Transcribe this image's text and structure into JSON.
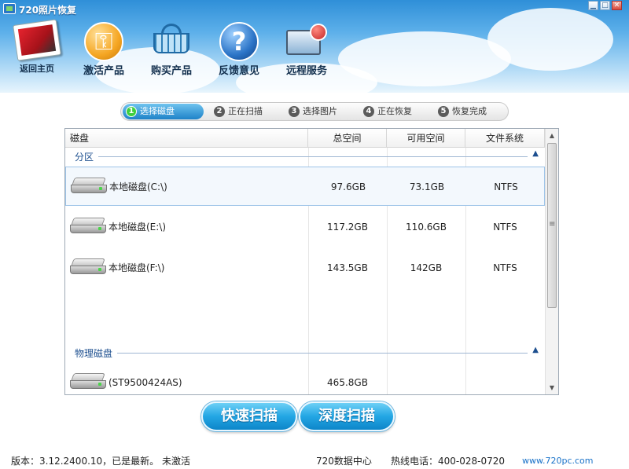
{
  "window": {
    "title": "720照片恢复",
    "controls": {
      "minimize": "▁",
      "maximize": "□",
      "close": "✕"
    }
  },
  "toolbar": {
    "home": "返回主页",
    "activate": "激活产品",
    "buy": "购买产品",
    "feedback": "反馈意见",
    "remote": "远程服务"
  },
  "steps": [
    {
      "num": "1",
      "label": "选择磁盘",
      "active": true
    },
    {
      "num": "2",
      "label": "正在扫描",
      "active": false
    },
    {
      "num": "3",
      "label": "选择图片",
      "active": false
    },
    {
      "num": "4",
      "label": "正在恢复",
      "active": false
    },
    {
      "num": "5",
      "label": "恢复完成",
      "active": false
    }
  ],
  "table": {
    "columns": {
      "disk": "磁盘",
      "total": "总空间",
      "free": "可用空间",
      "fs": "文件系统"
    },
    "partition_group": "分区",
    "physical_group": "物理磁盘",
    "chevron": "▲",
    "partitions": [
      {
        "name": "本地磁盘(C:\\)",
        "total": "97.6GB",
        "free": "73.1GB",
        "fs": "NTFS"
      },
      {
        "name": "本地磁盘(E:\\)",
        "total": "117.2GB",
        "free": "110.6GB",
        "fs": "NTFS"
      },
      {
        "name": "本地磁盘(F:\\)",
        "total": "143.5GB",
        "free": "142GB",
        "fs": "NTFS"
      }
    ],
    "physical": [
      {
        "name": "(ST9500424AS)",
        "total": "465.8GB"
      }
    ]
  },
  "scrollbar": {
    "up": "▲",
    "down": "▼",
    "grip": "≡"
  },
  "buttons": {
    "quick_scan": "快速扫描",
    "deep_scan": "深度扫描"
  },
  "footer": {
    "version": "版本：3.12.2400.10，已是最新。",
    "activation": "未激活",
    "data_center": "720数据中心",
    "hotline": "热线电话：400-028-0720",
    "website": "www.720pc.com"
  }
}
